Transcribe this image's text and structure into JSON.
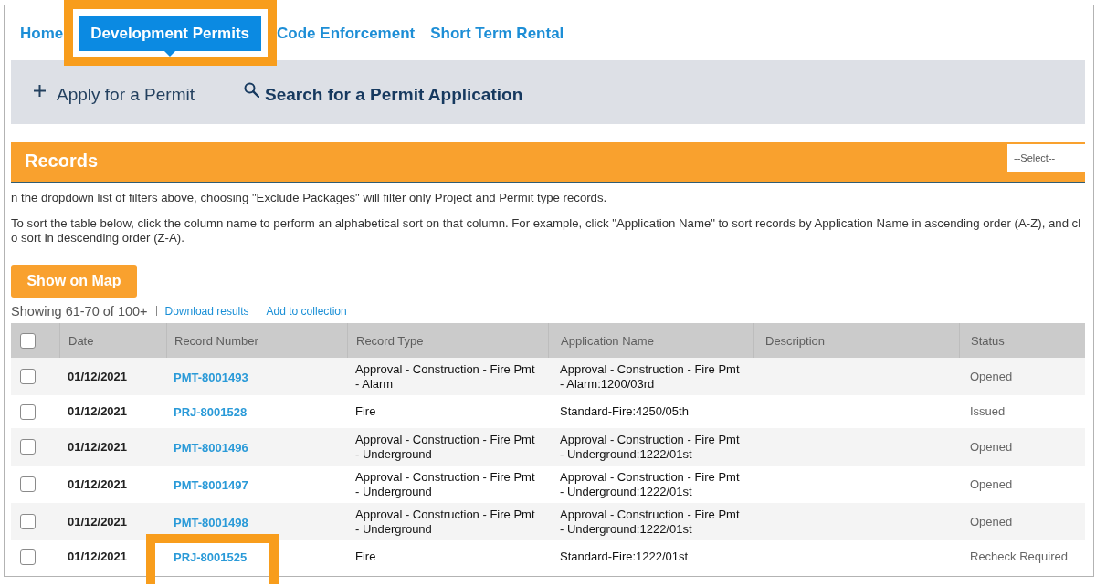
{
  "nav": {
    "tabs": [
      {
        "label": "Home",
        "selected": false,
        "highlighted": false
      },
      {
        "label": "Development Permits",
        "selected": true,
        "highlighted": true
      },
      {
        "label": "Code Enforcement",
        "selected": false,
        "highlighted": false
      },
      {
        "label": "Short Term Rental",
        "selected": false,
        "highlighted": false
      }
    ]
  },
  "actions": [
    {
      "kind": "apply",
      "label": "Apply for a Permit"
    },
    {
      "kind": "search",
      "label": "Search for a Permit Application"
    }
  ],
  "records": {
    "title": "Records",
    "filter": {
      "value": "--Select--"
    },
    "notes": [
      {
        "lines": [
          "n the dropdown list of filters above, choosing \"Exclude Packages\" will filter only Project and Permit type records."
        ]
      },
      {
        "lines": [
          "To sort the table below, click the column name to perform an alphabetical sort on that column. For example, click \"Application Name\" to sort records by Application Name in ascending order (A-Z), and cl",
          "o sort in descending order (Z-A)."
        ]
      }
    ],
    "map_button": "Show on Map",
    "summary": "Showing 61-70 of 100+",
    "links": [
      "Download results",
      "Add to collection"
    ],
    "table": {
      "select_all": {
        "checked": false
      },
      "columns": [
        "Date",
        "Record Number",
        "Record Type",
        "Application Name",
        "Description",
        "Status"
      ],
      "rows": [
        {
          "checked": false,
          "date": "01/12/2021",
          "record_number": "PMT-8001493",
          "highlighted": false,
          "record_type": "Approval - Construction - Fire Pmt - Alarm",
          "application_name": "Approval - Construction - Fire Pmt - Alarm:1200/03rd",
          "status": "Opened"
        },
        {
          "checked": false,
          "date": "01/12/2021",
          "record_number": "PRJ-8001528",
          "highlighted": false,
          "record_type": "Fire",
          "application_name": "Standard-Fire:4250/05th",
          "status": "Issued"
        },
        {
          "checked": false,
          "date": "01/12/2021",
          "record_number": "PMT-8001496",
          "highlighted": false,
          "record_type": "Approval - Construction - Fire Pmt - Underground",
          "application_name": "Approval - Construction - Fire Pmt - Underground:1222/01st",
          "status": "Opened"
        },
        {
          "checked": false,
          "date": "01/12/2021",
          "record_number": "PMT-8001497",
          "highlighted": false,
          "record_type": "Approval - Construction - Fire Pmt - Underground",
          "application_name": "Approval - Construction - Fire Pmt - Underground:1222/01st",
          "status": "Opened"
        },
        {
          "checked": false,
          "date": "01/12/2021",
          "record_number": "PMT-8001498",
          "highlighted": false,
          "record_type": "Approval - Construction - Fire Pmt - Underground",
          "application_name": "Approval - Construction - Fire Pmt - Underground:1222/01st",
          "status": "Opened"
        },
        {
          "checked": false,
          "date": "01/12/2021",
          "record_number": "PRJ-8001525",
          "highlighted": true,
          "record_type": "Fire",
          "application_name": "Standard-Fire:1222/01st",
          "status": "Recheck Required"
        }
      ]
    }
  }
}
